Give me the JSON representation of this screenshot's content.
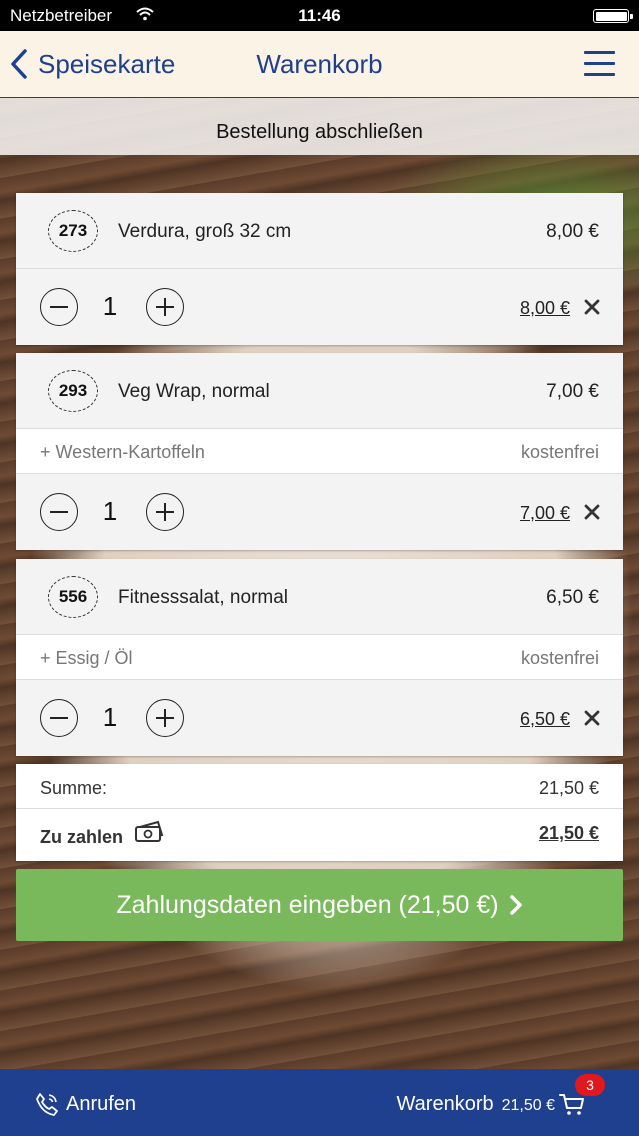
{
  "status_bar": {
    "carrier": "Netzbetreiber",
    "time": "11:46"
  },
  "nav": {
    "back_label": "Speisekarte",
    "title": "Warenkorb"
  },
  "section_title": "Bestellung abschließen",
  "items": [
    {
      "number": "273",
      "name": "Verdura, groß 32 cm",
      "price": "8,00 €",
      "extras": [],
      "quantity": "1",
      "line_total": "8,00 €"
    },
    {
      "number": "293",
      "name": "Veg Wrap, normal",
      "price": "7,00 €",
      "extras": [
        {
          "name": "+ Western-Kartoffeln",
          "price": "kostenfrei"
        }
      ],
      "quantity": "1",
      "line_total": "7,00 €"
    },
    {
      "number": "556",
      "name": "Fitnesssalat, normal",
      "price": "6,50 €",
      "extras": [
        {
          "name": "+ Essig / Öl",
          "price": "kostenfrei"
        }
      ],
      "quantity": "1",
      "line_total": "6,50 €"
    }
  ],
  "summary": {
    "sum_label": "Summe:",
    "sum_value": "21,50 €",
    "pay_label": "Zu zahlen",
    "pay_value": "21,50 €"
  },
  "cta_label": "Zahlungsdaten eingeben (21,50 €)",
  "bottom_bar": {
    "call_label": "Anrufen",
    "cart_label": "Warenkorb",
    "cart_total": "21,50 €",
    "cart_count": "3"
  },
  "colors": {
    "brand_blue": "#1f3f8f",
    "cta_green": "#79b95b",
    "badge_red": "#e0191f"
  }
}
